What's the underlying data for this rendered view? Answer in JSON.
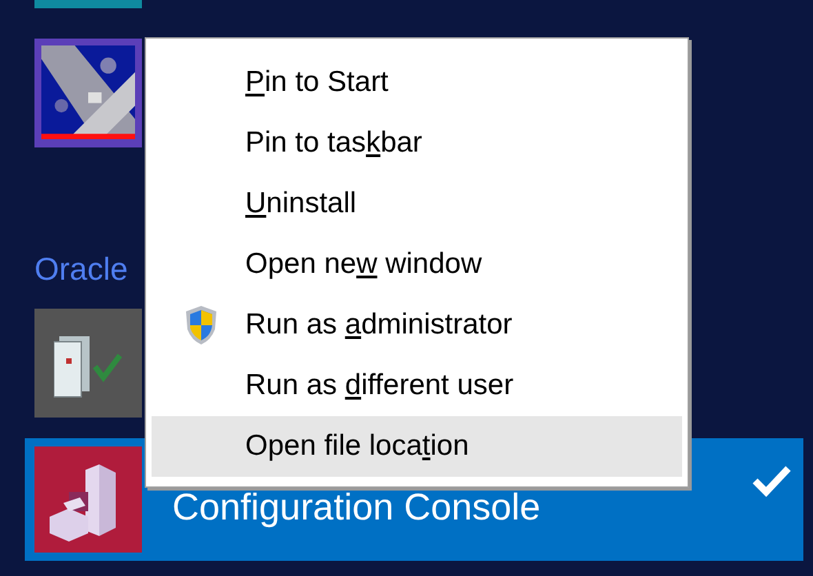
{
  "start_items": [
    {
      "kind": "teal"
    },
    {
      "kind": "picture"
    },
    {
      "kind": "header",
      "title": "Oracle"
    },
    {
      "kind": "server"
    },
    {
      "kind": "app",
      "label": "Configuration Console",
      "selected": true
    }
  ],
  "context_menu": {
    "items": [
      {
        "kind": "plain",
        "label": [
          {
            "text": "P",
            "underlined": true
          },
          {
            "text": "in to Start",
            "underlined": false
          }
        ],
        "selected": false
      },
      {
        "kind": "plain",
        "label": [
          {
            "text": "Pin to tas",
            "underlined": false
          },
          {
            "text": "k",
            "underlined": true
          },
          {
            "text": "bar",
            "underlined": false
          }
        ],
        "selected": false
      },
      {
        "kind": "plain",
        "label": [
          {
            "text": "U",
            "underlined": true
          },
          {
            "text": "ninstall",
            "underlined": false
          }
        ],
        "selected": false
      },
      {
        "kind": "plain",
        "label": [
          {
            "text": "Open ne",
            "underlined": false
          },
          {
            "text": "w",
            "underlined": true
          },
          {
            "text": " window",
            "underlined": false
          }
        ],
        "selected": false
      },
      {
        "kind": "shield",
        "label": [
          {
            "text": "Run as ",
            "underlined": false
          },
          {
            "text": "a",
            "underlined": true
          },
          {
            "text": "dministrator",
            "underlined": false
          }
        ],
        "selected": false
      },
      {
        "kind": "plain",
        "label": [
          {
            "text": "Run as ",
            "underlined": false
          },
          {
            "text": "d",
            "underlined": true
          },
          {
            "text": "ifferent user",
            "underlined": false
          }
        ],
        "selected": false
      },
      {
        "kind": "plain",
        "label": [
          {
            "text": "Open file loca",
            "underlined": false
          },
          {
            "text": "t",
            "underlined": true
          },
          {
            "text": "ion",
            "underlined": false
          }
        ],
        "selected": true
      }
    ]
  }
}
